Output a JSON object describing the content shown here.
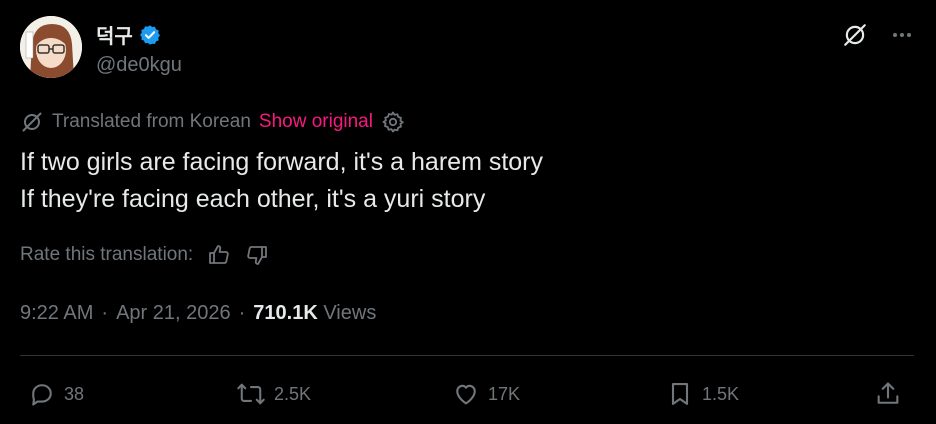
{
  "author": {
    "display_name": "덕구",
    "handle": "@de0kgu",
    "verified": true
  },
  "translation": {
    "label": "Translated from Korean",
    "show_original": "Show original"
  },
  "tweet": {
    "line1": "If two girls are facing forward, it's a harem story",
    "line2": "If they're facing each other, it's a yuri story"
  },
  "rate": {
    "label": "Rate this translation:"
  },
  "meta": {
    "time": "9:22 AM",
    "date": "Apr 21, 2026",
    "views_count": "710.1K",
    "views_label": "Views",
    "separator": "·"
  },
  "actions": {
    "replies": "38",
    "reposts": "2.5K",
    "likes": "17K",
    "bookmarks": "1.5K"
  },
  "colors": {
    "accent_pink": "#f91880",
    "verified_blue": "#1d9bf0",
    "muted": "#71767b"
  },
  "icons": [
    "grok-icon",
    "more-icon",
    "translate-icon",
    "gear-icon",
    "thumbs-up-icon",
    "thumbs-down-icon",
    "reply-icon",
    "repost-icon",
    "like-icon",
    "bookmark-icon",
    "share-icon",
    "verified-badge-icon"
  ]
}
